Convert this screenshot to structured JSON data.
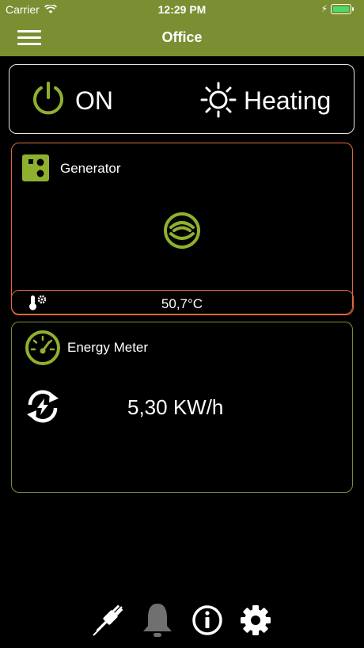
{
  "status_bar": {
    "carrier": "Carrier",
    "time": "12:29 PM"
  },
  "header": {
    "title": "Office"
  },
  "mode_card": {
    "power_state": "ON",
    "mode": "Heating"
  },
  "generator_card": {
    "label": "Generator",
    "temperature": "50,7°C"
  },
  "energy_card": {
    "label": "Energy Meter",
    "value": "5,30 KW/h"
  },
  "colors": {
    "accent": "#7a8f32",
    "generator_border": "#e0683a",
    "icon_green": "#8fb02f"
  },
  "bottom_nav": {
    "icons": [
      "plug-icon",
      "bell-icon",
      "info-icon",
      "gear-icon"
    ]
  }
}
